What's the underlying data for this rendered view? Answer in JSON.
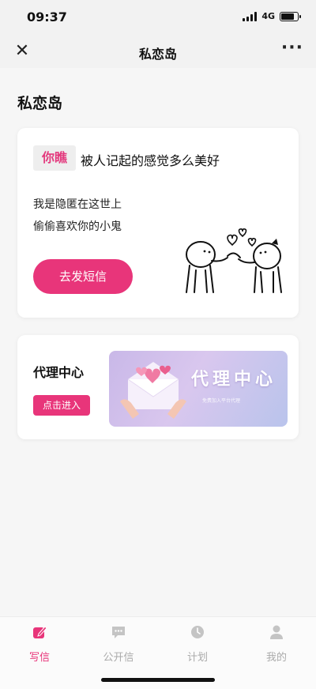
{
  "status": {
    "time": "09:37",
    "network": "4G"
  },
  "navbar": {
    "title": "私恋岛"
  },
  "page": {
    "title": "私恋岛"
  },
  "card": {
    "tag": "你瞧",
    "headline": "被人记起的感觉多么美好",
    "lines": [
      "我是隐匿在这世上",
      "偷偷喜欢你的小鬼"
    ],
    "button_label": "去发短信"
  },
  "agent": {
    "title": "代理中心",
    "button_label": "点击进入",
    "banner_title": "代理中心",
    "banner_subtitle": "免费加入平台代理"
  },
  "tabs": [
    {
      "label": "写信",
      "icon": "pen-icon",
      "active": true
    },
    {
      "label": "公开信",
      "icon": "chat-bubble-icon",
      "active": false
    },
    {
      "label": "计划",
      "icon": "clock-icon",
      "active": false
    },
    {
      "label": "我的",
      "icon": "user-icon",
      "active": false
    }
  ],
  "colors": {
    "accent": "#e8357a",
    "inactive": "#aaaaaa"
  }
}
